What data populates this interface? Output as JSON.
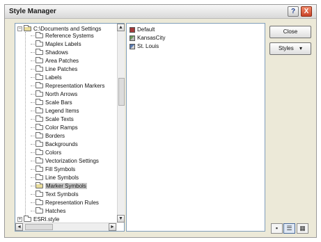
{
  "window": {
    "title": "Style Manager",
    "help_label": "?",
    "close_label": "X"
  },
  "tree": {
    "root": {
      "expander": "−",
      "label": "C:\\Documents and Settings"
    },
    "items": [
      {
        "label": "Reference Systems"
      },
      {
        "label": "Maplex Labels"
      },
      {
        "label": "Shadows"
      },
      {
        "label": "Area Patches"
      },
      {
        "label": "Line Patches"
      },
      {
        "label": "Labels"
      },
      {
        "label": "Representation Markers"
      },
      {
        "label": "North Arrows"
      },
      {
        "label": "Scale Bars"
      },
      {
        "label": "Legend Items"
      },
      {
        "label": "Scale Texts"
      },
      {
        "label": "Color Ramps"
      },
      {
        "label": "Borders"
      },
      {
        "label": "Backgrounds"
      },
      {
        "label": "Colors"
      },
      {
        "label": "Vectorization Settings"
      },
      {
        "label": "Fill Symbols"
      },
      {
        "label": "Line Symbols"
      },
      {
        "label": "Marker Symbols",
        "selected": true
      },
      {
        "label": "Text Symbols"
      },
      {
        "label": "Representation Rules"
      },
      {
        "label": "Hatches"
      }
    ],
    "second_root": {
      "expander": "+",
      "label": "ESRI.style"
    },
    "scroll_up": "▲",
    "scroll_down": "▼",
    "scroll_left": "◄",
    "scroll_right": "►"
  },
  "styles_list": [
    {
      "label": "Default",
      "icon": "style-default-icon"
    },
    {
      "label": "KansasCity",
      "icon": "style-kansascity-icon"
    },
    {
      "label": "St. Louis",
      "icon": "style-stlouis-icon"
    }
  ],
  "buttons": {
    "close": "Close",
    "styles": "Styles",
    "styles_arrow": "▾"
  },
  "view_buttons": {
    "large_icons": "▪",
    "list": "☰",
    "details": "▦"
  }
}
